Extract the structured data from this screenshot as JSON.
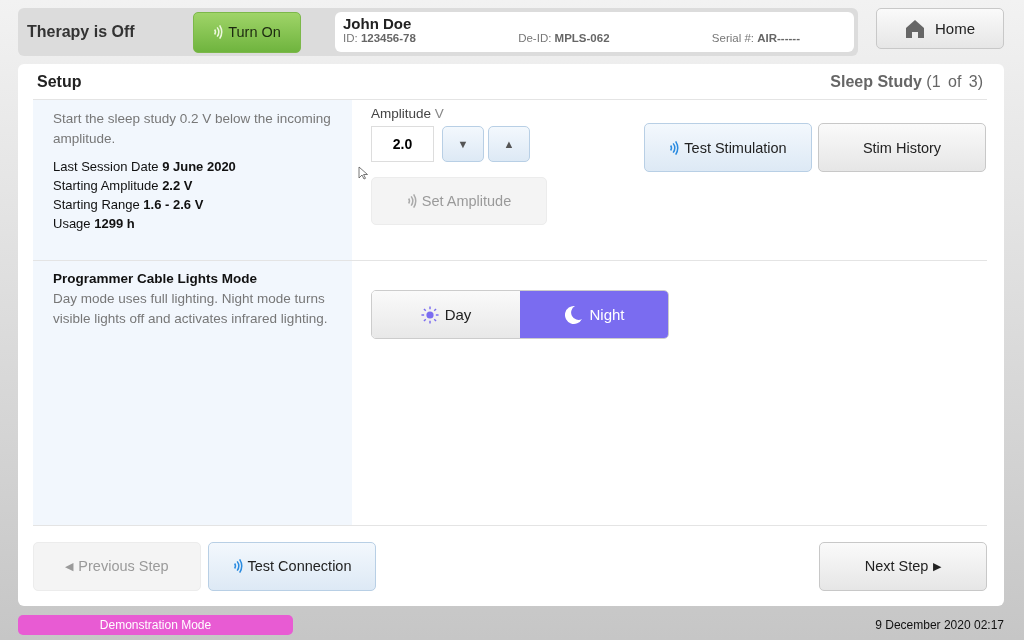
{
  "therapy": {
    "status": "Therapy is Off",
    "button": "Turn On"
  },
  "patient": {
    "name": "John Doe",
    "fields": [
      {
        "label": "ID:",
        "value": "123456-78"
      },
      {
        "label": "De-ID:",
        "value": "MPLS-062"
      },
      {
        "label": "Serial #:",
        "value": "AIR------"
      }
    ]
  },
  "home_button": "Home",
  "setup": {
    "title": "Setup",
    "step_title": "Sleep Study",
    "step_count": "(1  of  3)"
  },
  "amplitude_section": {
    "description": "Start the sleep study 0.2 V below the incoming amplitude.",
    "info": [
      {
        "label": "Last Session Date",
        "value": "9 June 2020"
      },
      {
        "label": "Starting Amplitude",
        "value": "2.2 V"
      },
      {
        "label": "Starting Range",
        "value": "1.6  -  2.6 V"
      },
      {
        "label": "Usage",
        "value": "1299 h"
      }
    ],
    "amplitude_label": "Amplitude",
    "unit": "V",
    "value": "2.0",
    "decrease": "▼",
    "increase": "▲",
    "set_button": {
      "label": "Set Amplitude",
      "disabled": true
    },
    "test_button": "Test Stimulation",
    "history_button": "Stim History"
  },
  "lights_section": {
    "title": "Programmer Cable Lights Mode",
    "description": "Day mode uses full lighting. Night mode turns visible lights off and activates infrared lighting.",
    "modes": [
      {
        "kind": "day",
        "label": "Day",
        "selected": false
      },
      {
        "kind": "night",
        "label": "Night",
        "selected": true
      }
    ]
  },
  "footer_buttons": {
    "previous": {
      "icon": "◀",
      "label": "Previous Step",
      "disabled": true
    },
    "test_connection": "Test Connection",
    "next": {
      "label": "Next Step",
      "icon": "▶",
      "disabled": false
    }
  },
  "status_bar": {
    "mode": "Demonstration Mode",
    "datetime": "9 December 2020 02:17"
  }
}
